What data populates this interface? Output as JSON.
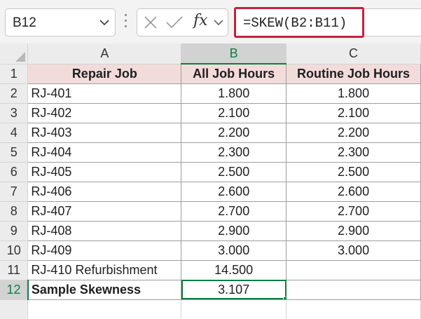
{
  "formula_bar": {
    "name_box": "B12",
    "fx_label": "fx",
    "formula": "=SKEW(B2:B11)"
  },
  "columns": [
    "A",
    "B",
    "C"
  ],
  "active_column": "B",
  "active_row": "12",
  "rows": [
    {
      "num": "1",
      "a": "Repair Job",
      "b": "All Job Hours",
      "c": "Routine Job Hours"
    },
    {
      "num": "2",
      "a": "RJ-401",
      "b": "1.800",
      "c": "1.800"
    },
    {
      "num": "3",
      "a": "RJ-402",
      "b": "2.100",
      "c": "2.100"
    },
    {
      "num": "4",
      "a": "RJ-403",
      "b": "2.200",
      "c": "2.200"
    },
    {
      "num": "5",
      "a": "RJ-404",
      "b": "2.300",
      "c": "2.300"
    },
    {
      "num": "6",
      "a": "RJ-405",
      "b": "2.500",
      "c": "2.500"
    },
    {
      "num": "7",
      "a": "RJ-406",
      "b": "2.600",
      "c": "2.600"
    },
    {
      "num": "8",
      "a": "RJ-407",
      "b": "2.700",
      "c": "2.700"
    },
    {
      "num": "9",
      "a": "RJ-408",
      "b": "2.900",
      "c": "2.900"
    },
    {
      "num": "10",
      "a": "RJ-409",
      "b": "3.000",
      "c": "3.000"
    },
    {
      "num": "11",
      "a": "RJ-410 Refurbishment",
      "b": "14.500",
      "c": ""
    },
    {
      "num": "12",
      "a": "Sample Skewness",
      "b": "3.107",
      "c": ""
    }
  ],
  "colors": {
    "header_fill": "#f2dcdb",
    "selection": "#107c41",
    "formula_highlight": "#c5213f"
  }
}
